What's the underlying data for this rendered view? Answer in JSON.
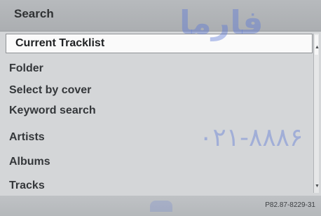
{
  "title": "Search",
  "menu": {
    "items": [
      {
        "label": "Current Tracklist",
        "selected": true
      },
      {
        "label": "Folder",
        "selected": false
      },
      {
        "label": "Select by cover",
        "selected": false
      },
      {
        "label": "Keyword search",
        "selected": false
      },
      {
        "label": "Artists",
        "selected": false
      },
      {
        "label": "Albums",
        "selected": false
      },
      {
        "label": "Tracks",
        "selected": false
      }
    ]
  },
  "scrollbar": {
    "up_icon": "arrow-up-icon",
    "down_icon": "arrow-down-icon"
  },
  "footer": {
    "code": "P82.87-8229-31"
  },
  "watermark": {
    "brand": "فارما",
    "phone": "۰۲۱-۸۸۸۶"
  },
  "colors": {
    "title_bar": "#afb2b5",
    "background": "#d4d6d8",
    "selected_bg": "#fafafa",
    "text": "#34373a",
    "watermark": "#5a76d6"
  }
}
